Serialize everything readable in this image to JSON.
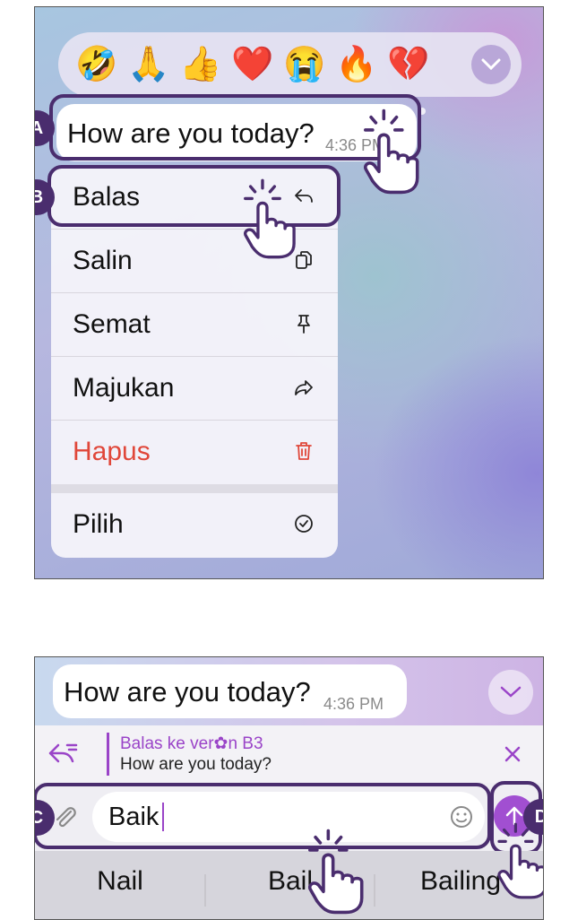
{
  "top_panel": {
    "reactions": [
      "🤣",
      "🙏",
      "👍",
      "❤️",
      "😭",
      "🔥",
      "💔"
    ],
    "message": {
      "text": "How are you today?",
      "time": "4:36 PM"
    },
    "badges": {
      "a": "A",
      "b": "B"
    },
    "menu": {
      "items": [
        {
          "label": "Balas",
          "icon": "reply-icon"
        },
        {
          "label": "Salin",
          "icon": "copy-icon"
        },
        {
          "label": "Semat",
          "icon": "pin-icon"
        },
        {
          "label": "Majukan",
          "icon": "forward-icon"
        },
        {
          "label": "Hapus",
          "icon": "trash-icon"
        },
        {
          "label": "Pilih",
          "icon": "check-circle-icon"
        }
      ]
    }
  },
  "bottom_panel": {
    "message": {
      "text": "How are you today?",
      "time": "4:36 PM"
    },
    "reply_preview": {
      "title": "Balas ke ver✿n B3",
      "quote": "How are you today?"
    },
    "composer": {
      "value": "Baik"
    },
    "suggestions": [
      "Nail",
      "Bail",
      "Bailing"
    ],
    "badges": {
      "c": "C",
      "d": "D"
    }
  },
  "colors": {
    "accent": "#4a2d6e",
    "delete": "#e0473a",
    "reply_accent": "#9a44c8"
  }
}
